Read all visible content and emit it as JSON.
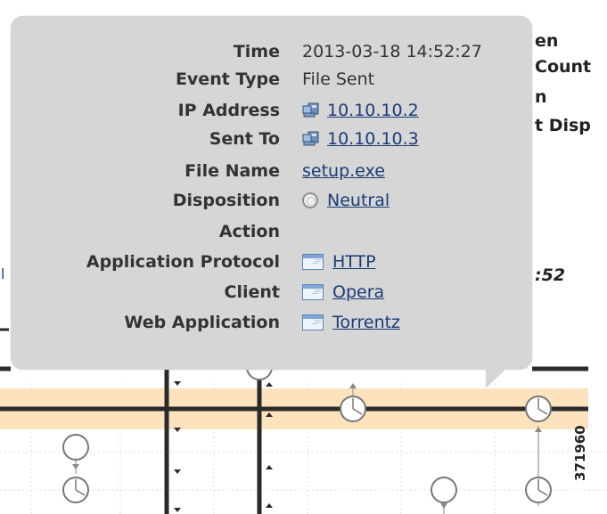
{
  "background": {
    "right_column_text": [
      "en",
      "Count",
      "n",
      "t Disp"
    ],
    "time_marker": ":52",
    "left_marker": "l",
    "figure_id": "371960"
  },
  "popup": {
    "rows": [
      {
        "label": "Time",
        "value": "2013-03-18 14:52:27",
        "icon": null,
        "link": false
      },
      {
        "label": "Event Type",
        "value": "File Sent",
        "icon": null,
        "link": false
      },
      {
        "label": "IP Address",
        "value": "10.10.10.2",
        "icon": "host-computer-icon",
        "link": true
      },
      {
        "label": "Sent To",
        "value": "10.10.10.3",
        "icon": "host-computer-icon",
        "link": true
      },
      {
        "label": "File Name",
        "value": "setup.exe",
        "icon": null,
        "link": true
      },
      {
        "label": "Disposition",
        "value": "Neutral",
        "icon": "disposition-neutral-icon",
        "link": true
      },
      {
        "label": "Action",
        "value": "",
        "icon": null,
        "link": false
      },
      {
        "label": "Application Protocol",
        "value": "HTTP",
        "icon": "application-window-icon",
        "link": true
      },
      {
        "label": "Client",
        "value": "Opera",
        "icon": "application-window-icon",
        "link": true
      },
      {
        "label": "Web Application",
        "value": "Torrentz",
        "icon": "application-window-icon",
        "link": true
      }
    ]
  },
  "colors": {
    "popup_bg": "#d6d6d6",
    "highlight_band": "#fde3bd",
    "link": "#1a3b78",
    "timeline_line": "#2a2a2a"
  }
}
